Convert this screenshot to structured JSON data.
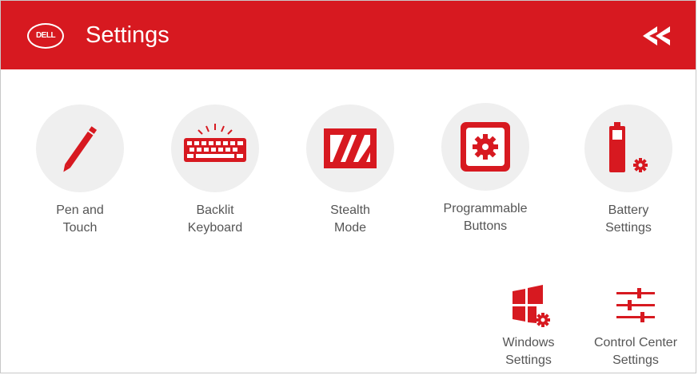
{
  "app": {
    "title": "Settings",
    "logo_text": "DELL",
    "accent": "#d71920"
  },
  "tiles": [
    {
      "label": "Pen and\nTouch",
      "icon": "pen-icon"
    },
    {
      "label": "Backlit\nKeyboard",
      "icon": "keyboard-icon"
    },
    {
      "label": "Stealth\nMode",
      "icon": "stealth-mode-icon"
    },
    {
      "label": "Programmable\nButtons",
      "icon": "gear-button-icon"
    },
    {
      "label": "Battery\nSettings",
      "icon": "battery-icon"
    }
  ],
  "shortcuts": [
    {
      "label": "Windows\nSettings",
      "icon": "windows-gear-icon"
    },
    {
      "label": "Control Center\nSettings",
      "icon": "sliders-icon"
    }
  ]
}
